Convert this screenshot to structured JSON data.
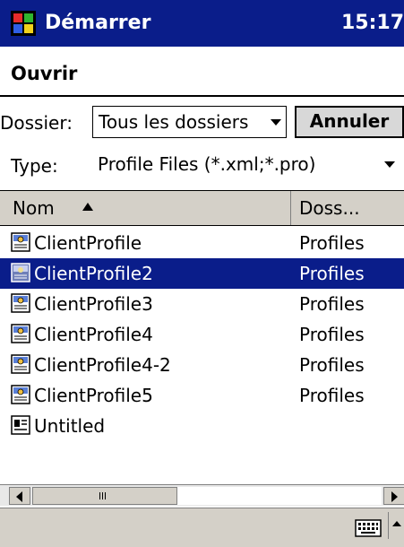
{
  "titlebar": {
    "title": "Démarrer",
    "clock": "15:17",
    "logo_icon": "windows-flag-icon"
  },
  "dialog": {
    "title": "Ouvrir"
  },
  "folder": {
    "label": "Dossier:",
    "value": "Tous les dossiers"
  },
  "cancel": {
    "label": "Annuler"
  },
  "type": {
    "label": "Type:",
    "value": "Profile Files (*.xml;*.pro)"
  },
  "list": {
    "columns": {
      "name": "Nom",
      "folder": "Doss..."
    },
    "rows": [
      {
        "name": "ClientProfile",
        "folder": "Profiles",
        "icon": "profile-file-icon"
      },
      {
        "name": "ClientProfile2",
        "folder": "Profiles",
        "icon": "profile-file-icon"
      },
      {
        "name": "ClientProfile3",
        "folder": "Profiles",
        "icon": "profile-file-icon"
      },
      {
        "name": "ClientProfile4",
        "folder": "Profiles",
        "icon": "profile-file-icon"
      },
      {
        "name": "ClientProfile4-2",
        "folder": "Profiles",
        "icon": "profile-file-icon"
      },
      {
        "name": "ClientProfile5",
        "folder": "Profiles",
        "icon": "profile-file-icon"
      },
      {
        "name": "Untitled",
        "folder": "",
        "icon": "document-file-icon"
      }
    ],
    "selected_index": 1
  },
  "colors": {
    "accent": "#0a1d8a",
    "chrome": "#d4d0c8"
  }
}
